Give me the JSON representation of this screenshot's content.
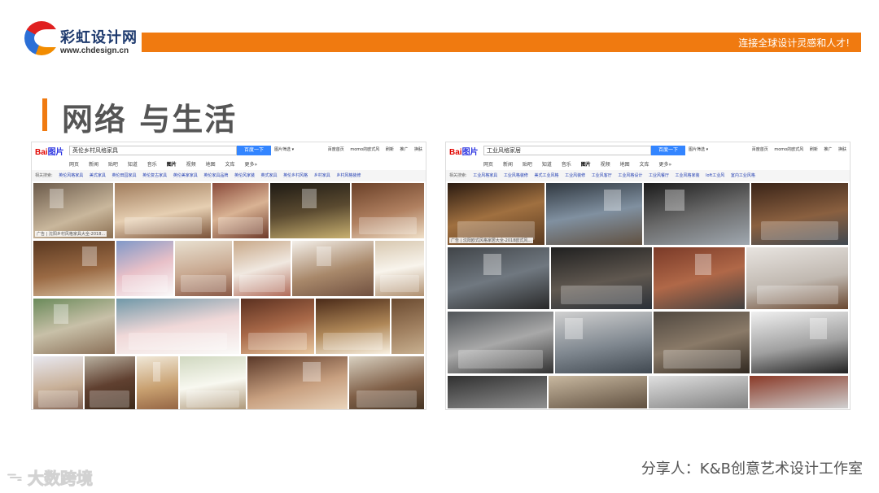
{
  "header": {
    "brand_name": "彩虹设计网",
    "brand_url": "www.chdesign.cn",
    "slogan": "连接全球设计灵感和人才!"
  },
  "page_title": "网络 与生活",
  "left_panel": {
    "logo_text_a": "Bai",
    "logo_text_b": "图片",
    "query": "英伦乡村风格家具",
    "search_button": "百度一下",
    "filter": "图片筛选 ▾",
    "top_links": "百度首页  momo的欧式风  刷新  推广 换肤",
    "nav": [
      "网页",
      "新闻",
      "贴吧",
      "知道",
      "音乐",
      "图片",
      "视频",
      "地图",
      "文库",
      "更多»"
    ],
    "related_label": "相关搜索:",
    "related": [
      "英伦风格家具",
      "美式家具",
      "英伦田园家具",
      "英伦复古家具",
      "英伦美家家具",
      "英伦家具品牌",
      "英伦风家装",
      "英式家具",
      "英伦乡村风格",
      "乡村家具",
      "乡村风格装修"
    ],
    "ad_caption": "广告 | 沈阳乡村风格家具大全-2018..."
  },
  "right_panel": {
    "logo_text_a": "Bai",
    "logo_text_b": "图片",
    "query": "工业风格家居",
    "search_button": "百度一下",
    "filter": "图片筛选 ▾",
    "top_links": "百度首页  momo的欧式风  刷新  推广 换肤",
    "nav": [
      "网页",
      "新闻",
      "贴吧",
      "知道",
      "音乐",
      "图片",
      "视频",
      "地图",
      "文库",
      "更多»"
    ],
    "related_label": "相关搜索:",
    "related": [
      "工业风格家具",
      "工业风格装修",
      "美式工业风格",
      "工业风装修",
      "工业风客厅",
      "工业风格设计",
      "工业风餐厅",
      "工业风格家装",
      "loft工业风",
      "室内工业风格"
    ],
    "ad_caption": "广告 | 沈阳欧式风格家居大全-2018欧式风..."
  },
  "footer": {
    "sharer": "分享人：K&B创意艺术设计工作室",
    "watermark": "大数跨境"
  },
  "colors": {
    "accent": "#f07a10",
    "title": "#555555",
    "baidu_blue": "#3385ff"
  }
}
